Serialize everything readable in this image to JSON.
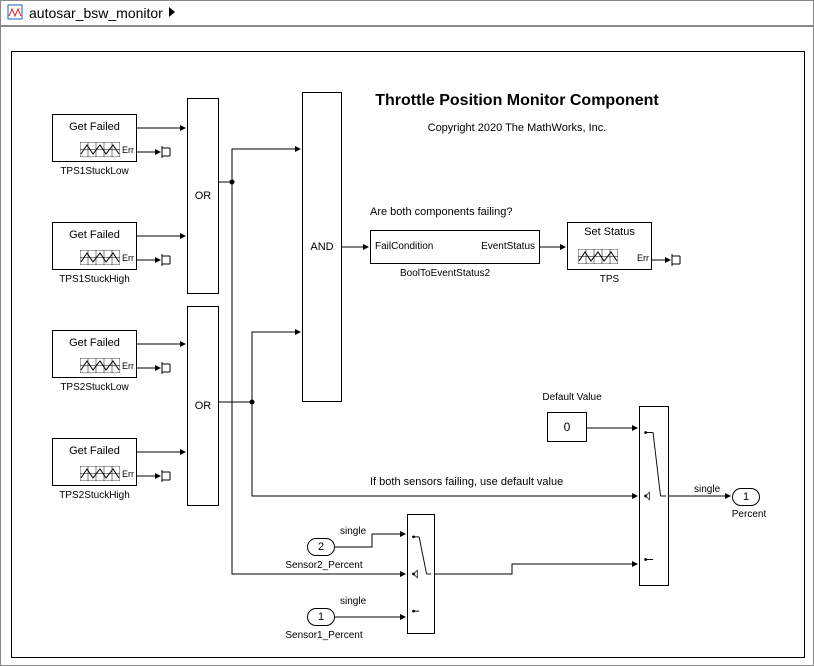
{
  "window": {
    "title": "autosar_bsw_monitor"
  },
  "header": {
    "title": "Throttle Position Monitor Component",
    "copyright": "Copyright 2020 The MathWorks, Inc."
  },
  "get_failed_label": "Get Failed",
  "err_label": "Err",
  "sources": {
    "tps1low": "TPS1StuckLow",
    "tps1high": "TPS1StuckHigh",
    "tps2low": "TPS2StuckLow",
    "tps2high": "TPS2StuckHigh"
  },
  "logic": {
    "or": "OR",
    "and": "AND"
  },
  "annotations": {
    "are_failing": "Are both components failing?",
    "use_default": "If both sensors failing, use default value",
    "default_value_label": "Default Value"
  },
  "subsystem": {
    "name": "BoolToEventStatus2",
    "in": "FailCondition",
    "out": "EventStatus"
  },
  "set_status": {
    "title": "Set Status",
    "name": "TPS"
  },
  "constant_value": "0",
  "data_types": {
    "single": "single"
  },
  "ports": {
    "in1_num": "1",
    "in1_name": "Sensor1_Percent",
    "in2_num": "2",
    "in2_name": "Sensor2_Percent",
    "out1_num": "1",
    "out1_name": "Percent"
  }
}
